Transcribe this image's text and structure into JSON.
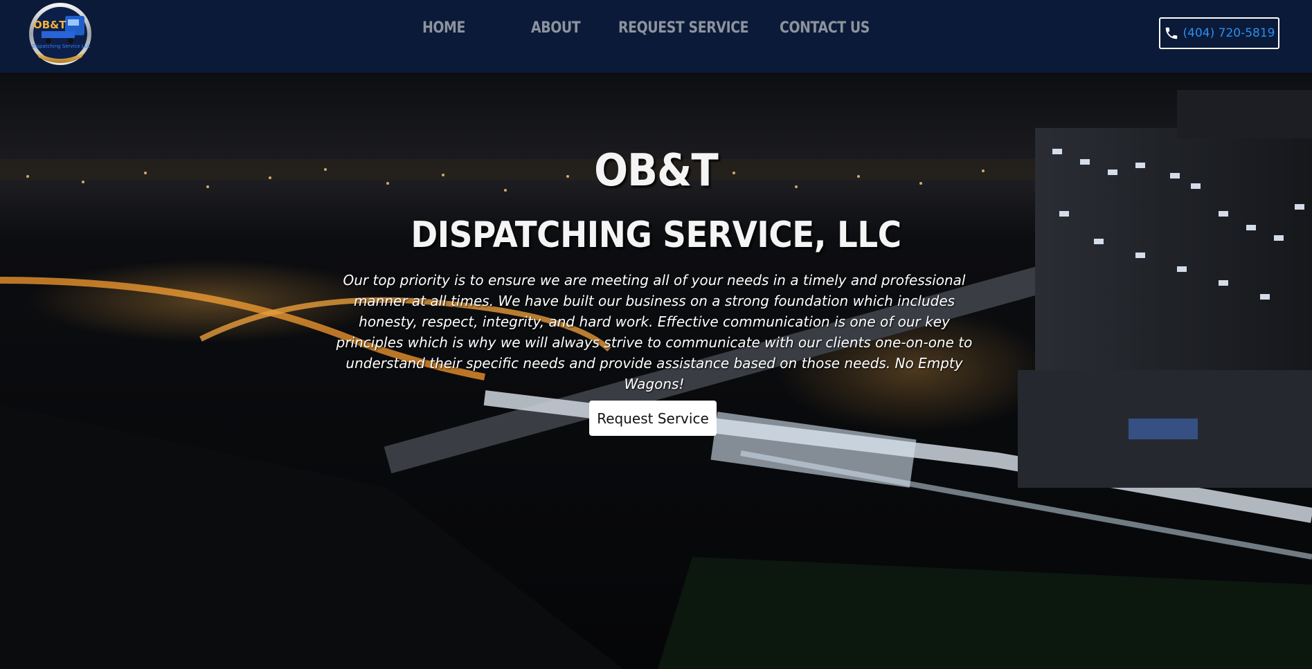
{
  "header": {
    "logo_icon": "ob-t-truck-logo",
    "logo_text_main": "OB&T",
    "logo_text_sub": "Dispatching Service LLC",
    "nav": [
      {
        "label": "HOME"
      },
      {
        "label": "ABOUT"
      },
      {
        "label": "REQUEST SERVICE"
      },
      {
        "label": "CONTACT US"
      }
    ],
    "phone_icon": "phone-icon",
    "phone": "(404) 720-5819"
  },
  "hero": {
    "title": "OB&T",
    "subtitle": "DISPATCHING SERVICE, LLC",
    "description": "Our top priority is to ensure we are meeting all of your needs in a timely and professional manner at all times. We have built our business on a strong foundation which includes honesty, respect, integrity, and hard work. Effective communication is one of our key principles which is why we will always strive to communicate with our clients one-on-one to understand their specific needs and provide assistance based on those needs. No Empty Wagons!",
    "cta_label": "Request Service",
    "background": "night-city-skyline-image"
  },
  "colors": {
    "header_bg": "#0b1a38",
    "nav_text": "#8d939e",
    "phone_text": "#2b8ff0",
    "cta_bg": "#ffffff"
  }
}
